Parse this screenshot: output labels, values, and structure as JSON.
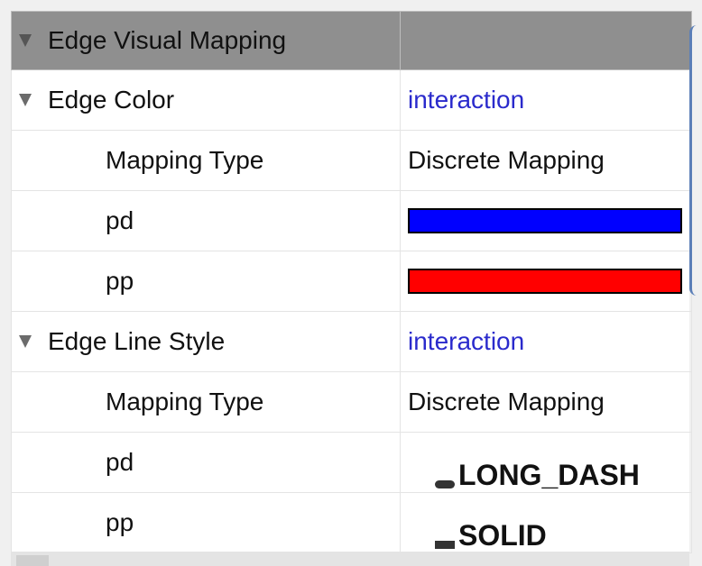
{
  "header": {
    "title": "Edge Visual Mapping",
    "value": ""
  },
  "edge_color": {
    "label": "Edge Color",
    "attribute": "interaction",
    "mapping_type_label": "Mapping Type",
    "mapping_type_value": "Discrete Mapping",
    "entries": [
      {
        "key": "pd",
        "color": "#0000ff"
      },
      {
        "key": "pp",
        "color": "#ff0000"
      }
    ]
  },
  "edge_line_style": {
    "label": "Edge Line Style",
    "attribute": "interaction",
    "mapping_type_label": "Mapping Type",
    "mapping_type_value": "Discrete Mapping",
    "entries": [
      {
        "key": "pd",
        "style": "LONG_DASH"
      },
      {
        "key": "pp",
        "style": "SOLID"
      }
    ]
  }
}
